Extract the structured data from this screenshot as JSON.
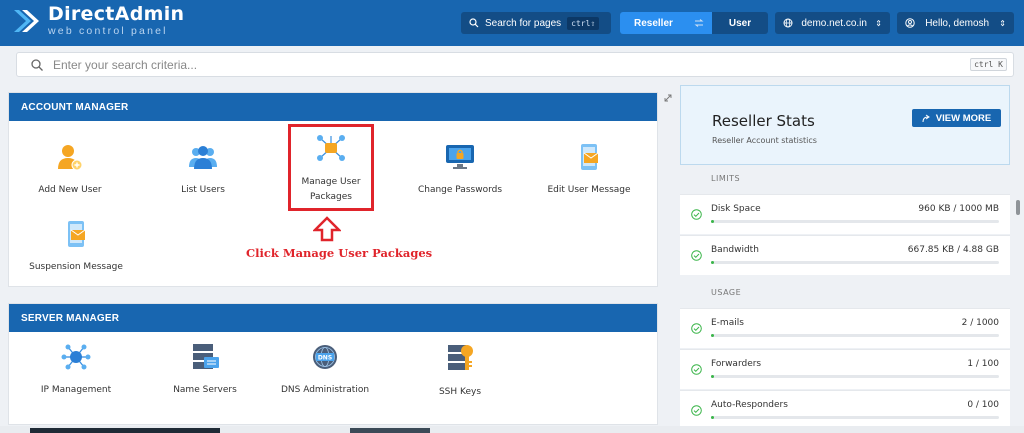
{
  "app": {
    "logo_title": "DirectAdmin",
    "logo_subtitle": "web control panel"
  },
  "topbar": {
    "search_label": "Search for pages",
    "search_shortcut": "ctrl⇧",
    "mode_reseller": "Reseller",
    "mode_user": "User",
    "domain": "demo.net.co.in",
    "greeting": "Hello, demosh"
  },
  "search": {
    "placeholder": "Enter your search criteria...",
    "shortcut": "ctrl K"
  },
  "account_manager": {
    "title": "ACCOUNT MANAGER",
    "items": [
      {
        "label": "Add New User"
      },
      {
        "label": "List Users"
      },
      {
        "label": "Manage User Packages"
      },
      {
        "label": "Change Passwords"
      },
      {
        "label": "Edit User Message"
      },
      {
        "label": "Suspension Message"
      }
    ]
  },
  "annotation": {
    "text": "Click Manage User Packages"
  },
  "server_manager": {
    "title": "SERVER MANAGER",
    "items": [
      {
        "label": "IP Management"
      },
      {
        "label": "Name Servers"
      },
      {
        "label": "DNS Administration"
      },
      {
        "label": "SSH Keys"
      }
    ]
  },
  "stats": {
    "title": "Reseller Stats",
    "subtitle": "Reseller Account statistics",
    "view_more": "VIEW MORE",
    "limits_label": "LIMITS",
    "usage_label": "USAGE",
    "rows": [
      {
        "name": "Disk Space",
        "value": "960 KB / 1000 MB",
        "fill_pct": 1
      },
      {
        "name": "Bandwidth",
        "value": "667.85 KB / 4.88 GB",
        "fill_pct": 1
      },
      {
        "name": "E-mails",
        "value": "2 / 1000",
        "fill_pct": 1
      },
      {
        "name": "Forwarders",
        "value": "1 / 100",
        "fill_pct": 1
      },
      {
        "name": "Auto-Responders",
        "value": "0 / 100",
        "fill_pct": 1
      }
    ]
  },
  "colors": {
    "brand": "#1866b0",
    "accent": "#2b8ff0",
    "highlight": "#e0242b",
    "success": "#3bb54a"
  }
}
